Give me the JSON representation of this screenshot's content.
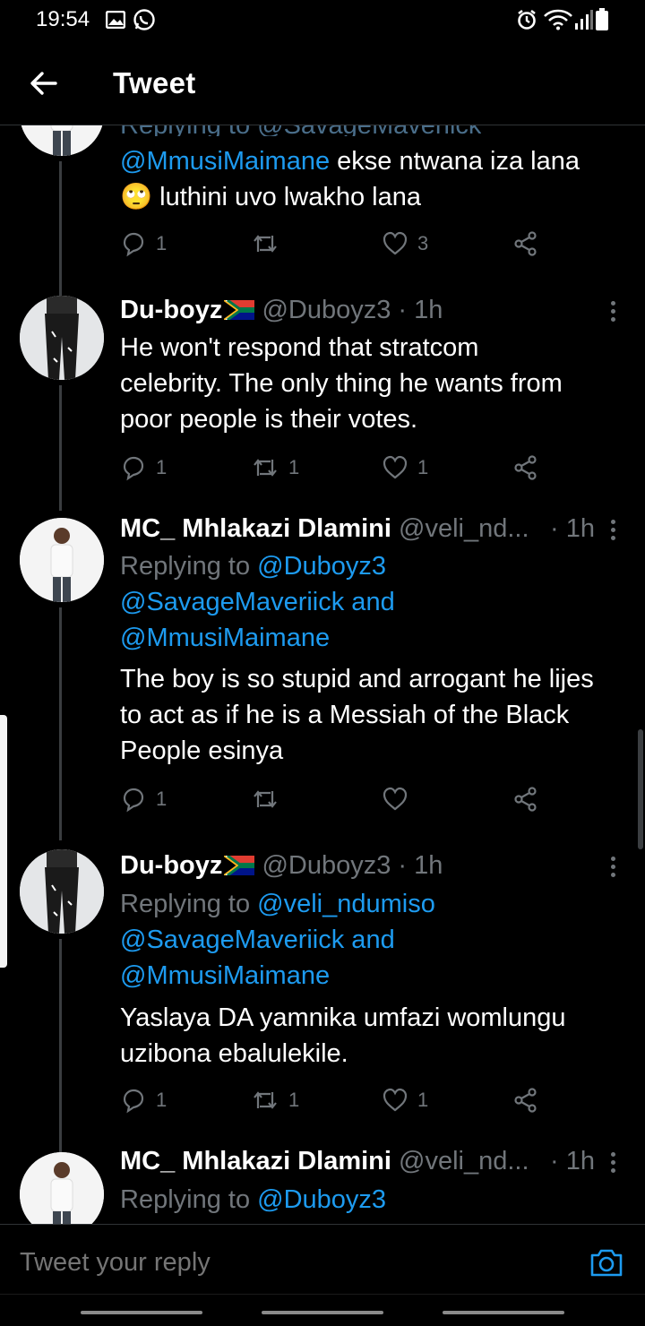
{
  "status_bar": {
    "time": "19:54",
    "left_icons": [
      "image-icon",
      "whatsapp-icon"
    ],
    "right_icons": [
      "alarm-icon",
      "wifi-icon",
      "signal-icon",
      "battery-icon"
    ]
  },
  "header": {
    "title": "Tweet",
    "back_icon": "back-arrow-icon"
  },
  "tweets": [
    {
      "partial_reply_line": "Replying to @SavageMaveriick",
      "text_mention": "@MmusiMaimane",
      "text_line1": " ekse ntwana iza lana",
      "emoji": "🙄",
      "text_line2": " luthini uvo lwakho lana",
      "replies": "1",
      "retweets": "",
      "likes": "3"
    },
    {
      "name": "Du-boyz",
      "handle": "@Duboyz3",
      "time": "1h",
      "text": [
        "He won't respond that stratcom",
        "celebrity. The only thing he wants from",
        "poor people is their votes."
      ],
      "replies": "1",
      "retweets": "1",
      "likes": "1"
    },
    {
      "name": "MC_ Mhlakazi Dlamini",
      "handle": "@veli_nd...",
      "time": "1h",
      "replying_prefix": "Replying to ",
      "replying_lines": [
        "@Duboyz3",
        "@SavageMaveriick and",
        "@MmusiMaimane"
      ],
      "text": [
        "The boy is so stupid and arrogant he lijes",
        "to act as if he is a Messiah of the Black",
        "People esinya"
      ],
      "replies": "1",
      "retweets": "",
      "likes": ""
    },
    {
      "name": "Du-boyz",
      "handle": "@Duboyz3",
      "time": "1h",
      "replying_prefix": "Replying to ",
      "replying_lines": [
        "@veli_ndumiso",
        "@SavageMaveriick and",
        "@MmusiMaimane"
      ],
      "text": [
        "Yaslaya DA yamnika umfazi womlungu",
        "uzibona ebalulekile."
      ],
      "replies": "1",
      "retweets": "1",
      "likes": "1"
    },
    {
      "name": "MC_ Mhlakazi Dlamini",
      "handle": "@veli_nd...",
      "time": "1h",
      "replying_prefix": "Replying to ",
      "replying_lines": [
        "@Duboyz3"
      ]
    }
  ],
  "reply_bar": {
    "placeholder": "Tweet your reply",
    "camera_icon": "camera-icon"
  },
  "colors": {
    "background": "#000000",
    "accent": "#1d9bf0",
    "muted": "#71767b",
    "divider": "#2f3336"
  }
}
